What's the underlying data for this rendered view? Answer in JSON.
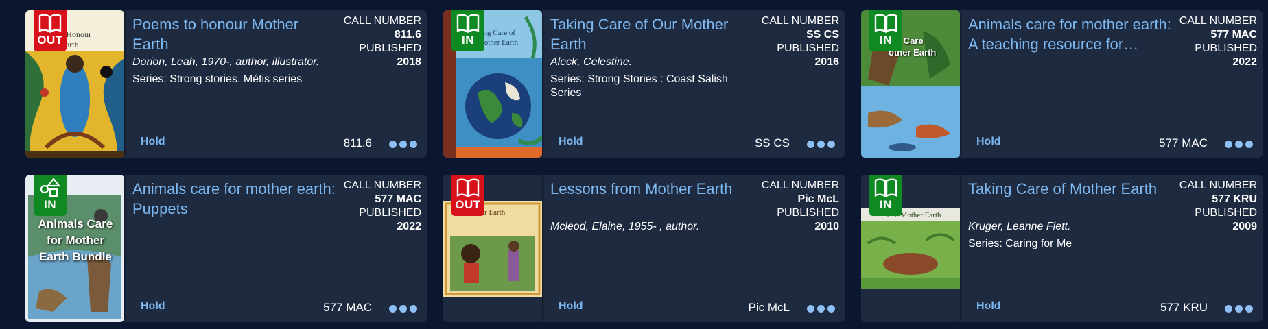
{
  "labels": {
    "call_number": "CALL NUMBER",
    "published": "PUBLISHED",
    "hold": "Hold"
  },
  "colors": {
    "background": "#0b1630",
    "card": "#1e2a40",
    "link": "#7db8f0",
    "out_badge": "#d8121a",
    "in_badge": "#0f8a23"
  },
  "items": [
    {
      "title": "Poems to honour Mother Earth",
      "author": "Dorion, Leah, 1970-, author, illustrator.",
      "series": "Series: Strong stories. Métis series",
      "call_number": "811.6",
      "published": "2018",
      "status": "OUT",
      "status_icon": "book-icon",
      "cover_text": "ms to Honour\nther Earth"
    },
    {
      "title": "Taking Care of Our Mother Earth",
      "author": "Aleck, Celestine.",
      "series": "Series: Strong Stories : Coast Salish Series",
      "call_number": "SS CS",
      "published": "2016",
      "status": "IN",
      "status_icon": "book-icon",
      "cover_text": "king Care of\nMother Earth"
    },
    {
      "title": "Animals care for mother earth: A teaching resource for…",
      "author": "",
      "series": "",
      "call_number": "577 MAC",
      "published": "2022",
      "status": "IN",
      "status_icon": "book-icon",
      "cover_text": "als Care\nother Earth"
    },
    {
      "title": "Animals care for mother earth: Puppets",
      "author": "",
      "series": "",
      "call_number": "577 MAC",
      "published": "2022",
      "status": "IN",
      "status_icon": "shapes-icon",
      "cover_text": "Animals Care\nfor Mother\nEarth Bundle"
    },
    {
      "title": "Lessons from Mother Earth",
      "author": "Mcleod, Elaine, 1955- , author.",
      "series": "",
      "call_number": "Pic McL",
      "published": "2010",
      "status": "OUT",
      "status_icon": "book-icon",
      "cover_text": "m Mother Earth"
    },
    {
      "title": "Taking Care of Mother Earth",
      "author": "Kruger, Leanne Flett.",
      "series": "Series: Caring for Me",
      "call_number": "577 KRU",
      "published": "2009",
      "status": "IN",
      "status_icon": "book-icon",
      "cover_text": "e of Mother Earth"
    }
  ]
}
